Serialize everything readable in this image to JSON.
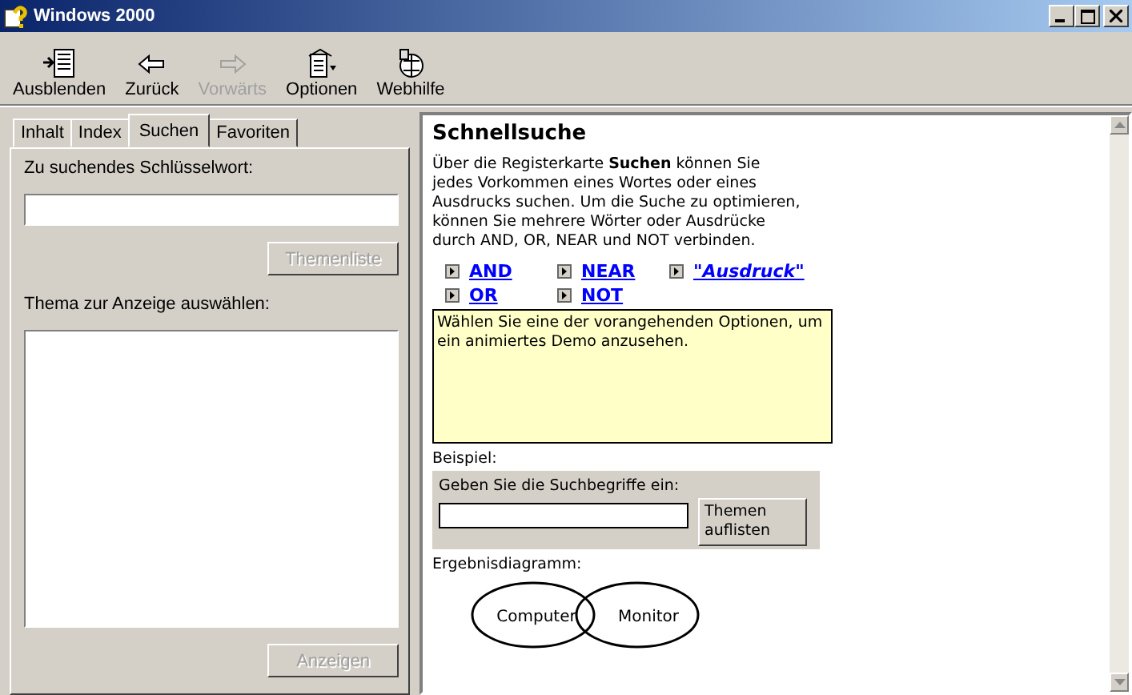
{
  "window": {
    "title": "Windows 2000"
  },
  "toolbar": [
    {
      "label": "Ausblenden",
      "kind": "hide",
      "disabled": false
    },
    {
      "label": "Zurück",
      "kind": "back",
      "disabled": false
    },
    {
      "label": "Vorwärts",
      "kind": "forward",
      "disabled": true
    },
    {
      "label": "Optionen",
      "kind": "options",
      "disabled": false
    },
    {
      "label": "Webhilfe",
      "kind": "web",
      "disabled": false
    }
  ],
  "tabs": [
    {
      "label": "Inhalt",
      "selected": false
    },
    {
      "label": "Index",
      "selected": false
    },
    {
      "label": "Suchen",
      "selected": true
    },
    {
      "label": "Favoriten",
      "selected": false
    }
  ],
  "search_pane": {
    "keyword_label": "Zu suchendes Schlüsselwort:",
    "list_topics_button": {
      "label": "Themenliste",
      "disabled": true
    },
    "topic_label": "Thema zur Anzeige auswählen:",
    "display_button": {
      "label": "Anzeigen",
      "disabled": true
    }
  },
  "content": {
    "heading": "Schnellsuche",
    "intro": "Über die Registerkarte **Suchen** können Sie jedes Vorkommen eines Wortes oder eines Ausdrucks suchen. Um die Suche zu optimieren, können Sie mehrere Wörter oder Ausdrücke durch AND, OR, NEAR und NOT verbinden.",
    "links": [
      {
        "label": "AND",
        "italic": false
      },
      {
        "label": "NEAR",
        "italic": false
      },
      {
        "label": "\"Ausdruck\"",
        "italic": true
      },
      {
        "label": "OR",
        "italic": false
      },
      {
        "label": "NOT",
        "italic": false
      }
    ],
    "demo_text": "Wählen Sie eine der vorangehenden Optionen, um ein animiertes Demo anzusehen.",
    "example_label": "Beispiel:",
    "example_prompt": "Geben Sie die Suchbegriffe ein:",
    "example_button": "Themen auflisten",
    "diagram_label": "Ergebnisdiagramm:",
    "diagram_terms": [
      "Computer",
      "Monitor"
    ]
  }
}
